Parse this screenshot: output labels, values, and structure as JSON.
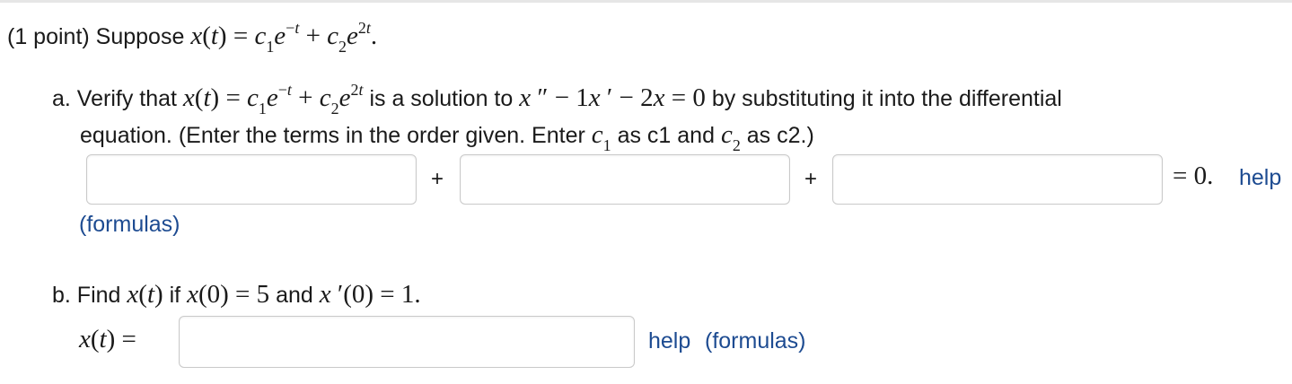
{
  "problem": {
    "points": "(1 point) Suppose",
    "part_a_intro": "a. Verify that",
    "part_a_mid": "is a solution to",
    "part_a_tail": "by substituting it into the differential",
    "part_a_line2_pre": "equation. (Enter the terms in the order given. Enter",
    "part_a_as1": "as c1 and",
    "part_a_as2": "as c2.)",
    "plus1": "+",
    "plus2": "+",
    "equals_zero": "= 0.",
    "help_a": "help",
    "formulas_a": "(formulas)",
    "part_b_pre": "b. Find",
    "part_b_if": "if",
    "part_b_and": "and",
    "xt_label": "x(t) =",
    "help_b": "help",
    "formulas_b": "(formulas)"
  },
  "inputs": {
    "a1": "",
    "a2": "",
    "a3": "",
    "b1": ""
  }
}
